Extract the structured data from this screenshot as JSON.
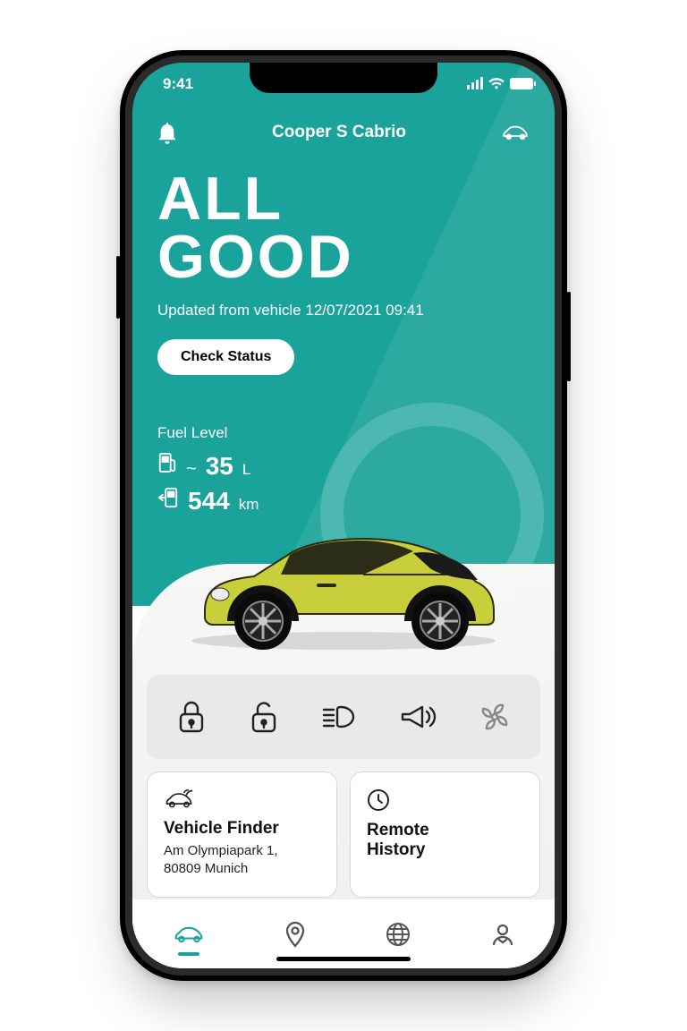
{
  "status": {
    "time": "9:41"
  },
  "header": {
    "title": "Cooper S Cabrio"
  },
  "hero": {
    "line1": "ALL",
    "line2": "GOOD",
    "updated": "Updated from vehicle 12/07/2021 09:41",
    "button": "Check Status"
  },
  "fuel": {
    "label": "Fuel Level",
    "tilde": "~",
    "amount": "35",
    "amount_unit": "L",
    "range": "544",
    "range_unit": "km"
  },
  "cards": {
    "finder": {
      "title": "Vehicle Finder",
      "address_line1": "Am Olympiapark 1,",
      "address_line2": "80809 Munich"
    },
    "history": {
      "title_line1": "Remote",
      "title_line2": "History"
    }
  },
  "colors": {
    "accent": "#1aa39a",
    "car_body": "#c8cf3a"
  }
}
